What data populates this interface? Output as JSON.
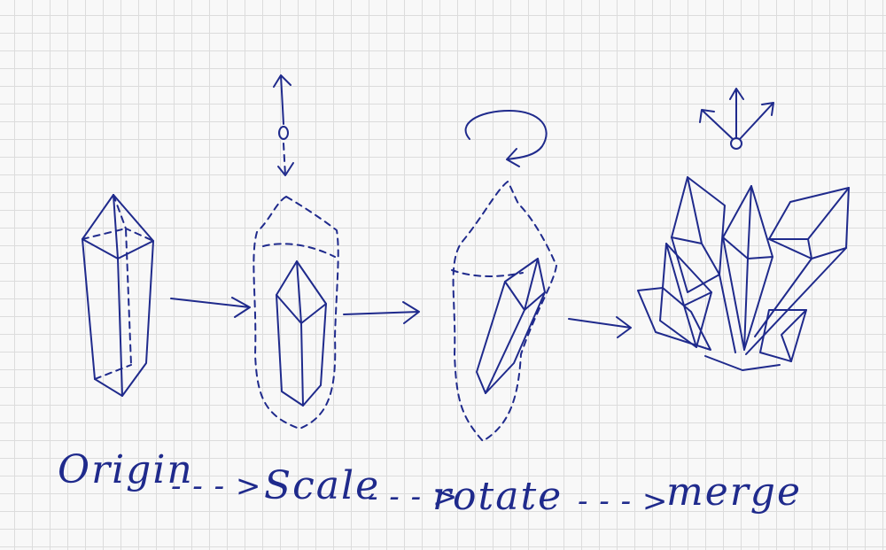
{
  "ink_color": "#1f2a8c",
  "grid_color": "#dcdcdc",
  "labels": {
    "origin": "Origin",
    "scale": "Scale",
    "rotate": "rotate",
    "merge": "merge"
  },
  "connectors": {
    "dotted_arrow": "- - - >"
  }
}
